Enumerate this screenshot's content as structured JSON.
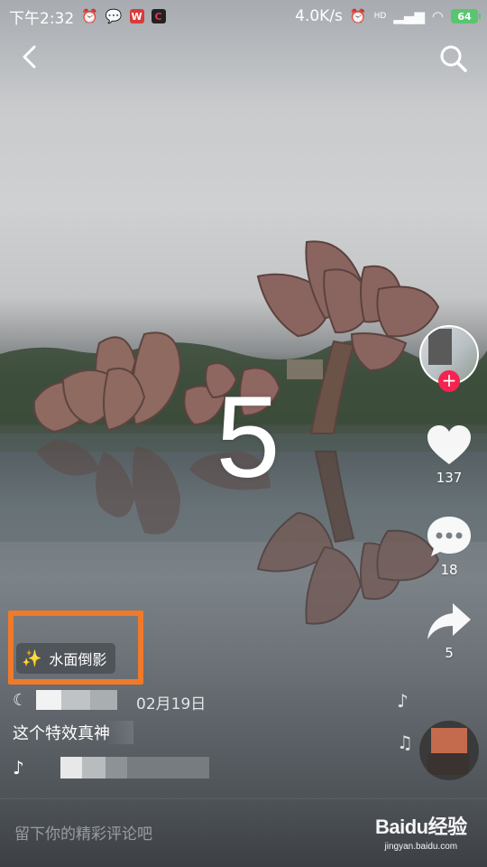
{
  "status_bar": {
    "time": "下午2:32",
    "network_speed": "4.0K/s",
    "signal_label": "HD",
    "battery_level": "64"
  },
  "video": {
    "countdown_number": "5",
    "effect_tag": "水面倒影"
  },
  "engagement": {
    "likes": "137",
    "comments": "18",
    "shares": "5"
  },
  "post": {
    "date": "02月19日",
    "caption": "这个特效真神"
  },
  "comment_bar": {
    "placeholder": "留下你的精彩评论吧"
  },
  "watermark": {
    "brand": "Baidu经验",
    "site": "jingyan.baidu.com"
  },
  "colors": {
    "follow_red": "#f5234f",
    "highlight_orange": "#f0792a",
    "battery_green": "#57c66f"
  }
}
